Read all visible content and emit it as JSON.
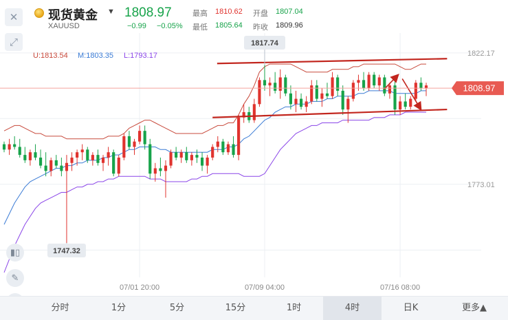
{
  "header": {
    "name": "现货黄金",
    "symbol": "XAUUSD",
    "price": "1808.97",
    "change": "−0.99",
    "change_pct": "−0.05%",
    "stats": [
      {
        "label": "最高",
        "value": "1810.62",
        "color": "#e0332e"
      },
      {
        "label": "开盘",
        "value": "1807.04",
        "color": "#17a34a"
      },
      {
        "label": "最低",
        "value": "1805.64",
        "color": "#17a34a"
      },
      {
        "label": "昨收",
        "value": "1809.96",
        "color": "#333333"
      }
    ]
  },
  "toolbar": {
    "close_icon": "close-icon",
    "expand_icon": "expand-icon",
    "side_tools": [
      "candle-type-icon",
      "pen-icon",
      "line-tool-icon"
    ]
  },
  "tabs": [
    {
      "label": "分时",
      "active": false
    },
    {
      "label": "1分",
      "active": false
    },
    {
      "label": "5分",
      "active": false
    },
    {
      "label": "15分",
      "active": false
    },
    {
      "label": "1时",
      "active": false
    },
    {
      "label": "4时",
      "active": true
    },
    {
      "label": "日K",
      "active": false
    },
    {
      "label": "更多▲",
      "active": false
    }
  ],
  "chart_data": {
    "type": "candlestick",
    "indicator": "Bollinger Bands",
    "bands_legend": {
      "upper": "U:1813.54",
      "middle": "M:1803.35",
      "lower": "L:1793.17"
    },
    "y_ticks": [
      "1822.17",
      "1773.01"
    ],
    "x_ticks": [
      "07/01 20:00",
      "07/09 04:00",
      "07/16 08:00"
    ],
    "last_price_label": "1808.97",
    "high_marker": "1817.74",
    "low_marker": "1747.32",
    "ylim": [
      1738.2,
      1829.6
    ],
    "colors": {
      "up": "#e0332e",
      "down": "#17a34a",
      "upper": "#c84a3c",
      "middle": "#3a7bd5",
      "lower": "#8a45e8"
    },
    "channel_lines": [
      {
        "from": [
          0.475,
          1818.2
        ],
        "to": [
          0.978,
          1820.0
        ]
      },
      {
        "from": [
          0.465,
          1798.0
        ],
        "to": [
          0.978,
          1801.0
        ]
      }
    ],
    "forecast_arrows": [
      {
        "from": [
          0.84,
          1808.5
        ],
        "to": [
          0.87,
          1813.8
        ]
      },
      {
        "from": [
          0.88,
          1812.5
        ],
        "to": [
          0.92,
          1801.2
        ]
      }
    ],
    "candles": [
      [
        1788.0,
        1789.0,
        1785.0,
        1786.0
      ],
      [
        1786.0,
        1790.0,
        1784.0,
        1788.0
      ],
      [
        1788.0,
        1791.0,
        1786.0,
        1787.0
      ],
      [
        1787.0,
        1790.0,
        1783.0,
        1784.0
      ],
      [
        1784.0,
        1787.0,
        1781.0,
        1782.0
      ],
      [
        1782.0,
        1786.0,
        1780.0,
        1785.0
      ],
      [
        1785.0,
        1788.0,
        1782.0,
        1783.0
      ],
      [
        1783.0,
        1786.0,
        1779.0,
        1780.0
      ],
      [
        1780.0,
        1785.0,
        1776.0,
        1778.0
      ],
      [
        1778.0,
        1783.0,
        1776.0,
        1782.0
      ],
      [
        1782.0,
        1784.0,
        1779.0,
        1780.0
      ],
      [
        1780.0,
        1783.0,
        1776.0,
        1778.0
      ],
      [
        1778.0,
        1784.0,
        1747.3,
        1781.0
      ],
      [
        1781.0,
        1785.0,
        1778.0,
        1783.0
      ],
      [
        1783.0,
        1786.0,
        1780.0,
        1785.0
      ],
      [
        1785.0,
        1788.0,
        1782.0,
        1786.0
      ],
      [
        1786.0,
        1787.0,
        1781.0,
        1782.0
      ],
      [
        1782.0,
        1785.0,
        1780.0,
        1784.0
      ],
      [
        1784.0,
        1786.0,
        1780.0,
        1781.0
      ],
      [
        1781.0,
        1784.0,
        1778.0,
        1783.0
      ],
      [
        1783.0,
        1787.0,
        1780.0,
        1785.0
      ],
      [
        1785.0,
        1786.0,
        1776.0,
        1777.0
      ],
      [
        1777.0,
        1784.0,
        1776.0,
        1783.0
      ],
      [
        1783.0,
        1792.0,
        1782.0,
        1791.0
      ],
      [
        1791.0,
        1793.0,
        1786.0,
        1787.0
      ],
      [
        1787.0,
        1790.0,
        1784.0,
        1789.0
      ],
      [
        1789.0,
        1795.0,
        1788.0,
        1793.0
      ],
      [
        1793.0,
        1795.0,
        1786.0,
        1788.0
      ],
      [
        1788.0,
        1790.0,
        1775.0,
        1777.0
      ],
      [
        1777.0,
        1781.0,
        1774.0,
        1779.0
      ],
      [
        1779.0,
        1783.0,
        1776.0,
        1778.0
      ],
      [
        1778.0,
        1782.0,
        1768.0,
        1780.0
      ],
      [
        1780.0,
        1786.0,
        1779.0,
        1785.0
      ],
      [
        1785.0,
        1787.0,
        1782.0,
        1783.0
      ],
      [
        1783.0,
        1786.0,
        1781.0,
        1785.0
      ],
      [
        1785.0,
        1787.0,
        1781.0,
        1782.0
      ],
      [
        1782.0,
        1785.0,
        1780.0,
        1784.0
      ],
      [
        1784.0,
        1786.0,
        1781.0,
        1783.0
      ],
      [
        1783.0,
        1785.0,
        1778.0,
        1780.0
      ],
      [
        1780.0,
        1784.0,
        1777.0,
        1783.0
      ],
      [
        1783.0,
        1788.0,
        1782.0,
        1787.0
      ],
      [
        1787.0,
        1791.0,
        1785.0,
        1789.0
      ],
      [
        1789.0,
        1790.0,
        1784.0,
        1785.0
      ],
      [
        1785.0,
        1789.0,
        1784.0,
        1788.0
      ],
      [
        1788.0,
        1791.0,
        1783.0,
        1784.0
      ],
      [
        1784.0,
        1799.0,
        1782.0,
        1798.0
      ],
      [
        1798.0,
        1803.0,
        1796.0,
        1800.0
      ],
      [
        1800.0,
        1802.0,
        1796.0,
        1797.0
      ],
      [
        1797.0,
        1805.0,
        1796.0,
        1803.0
      ],
      [
        1803.0,
        1813.0,
        1802.0,
        1812.0
      ],
      [
        1812.0,
        1817.7,
        1808.0,
        1810.0
      ],
      [
        1810.0,
        1813.0,
        1806.0,
        1811.0
      ],
      [
        1811.0,
        1815.0,
        1807.0,
        1808.0
      ],
      [
        1808.0,
        1816.0,
        1805.0,
        1813.0
      ],
      [
        1813.0,
        1814.0,
        1806.0,
        1807.0
      ],
      [
        1807.0,
        1810.0,
        1801.0,
        1803.0
      ],
      [
        1803.0,
        1808.0,
        1800.0,
        1805.0
      ],
      [
        1805.0,
        1807.0,
        1801.0,
        1802.0
      ],
      [
        1802.0,
        1806.0,
        1800.0,
        1804.0
      ],
      [
        1804.0,
        1812.0,
        1803.0,
        1810.0
      ],
      [
        1810.0,
        1812.0,
        1804.0,
        1805.0
      ],
      [
        1805.0,
        1809.0,
        1802.0,
        1807.0
      ],
      [
        1807.0,
        1811.0,
        1805.0,
        1806.0
      ],
      [
        1806.0,
        1815.0,
        1805.0,
        1813.0
      ],
      [
        1813.0,
        1814.0,
        1806.0,
        1808.0
      ],
      [
        1808.0,
        1810.0,
        1799.0,
        1801.0
      ],
      [
        1801.0,
        1806.0,
        1796.0,
        1805.0
      ],
      [
        1805.0,
        1812.0,
        1804.0,
        1811.0
      ],
      [
        1811.0,
        1814.0,
        1808.0,
        1812.0
      ],
      [
        1812.0,
        1815.0,
        1808.0,
        1809.0
      ],
      [
        1809.0,
        1815.0,
        1808.0,
        1814.0
      ],
      [
        1814.0,
        1815.0,
        1809.0,
        1810.0
      ],
      [
        1810.0,
        1814.0,
        1808.0,
        1813.0
      ],
      [
        1813.0,
        1814.0,
        1806.0,
        1807.0
      ],
      [
        1807.0,
        1811.0,
        1805.0,
        1810.0
      ],
      [
        1810.0,
        1812.0,
        1799.0,
        1801.0
      ],
      [
        1801.0,
        1806.0,
        1799.0,
        1804.0
      ],
      [
        1804.0,
        1807.0,
        1801.0,
        1802.0
      ],
      [
        1802.0,
        1806.0,
        1801.0,
        1805.0
      ],
      [
        1805.0,
        1812.0,
        1804.0,
        1811.0
      ],
      [
        1811.0,
        1813.0,
        1808.0,
        1809.0
      ],
      [
        1809.0,
        1811.0,
        1806.0,
        1810.0
      ]
    ],
    "bb_upper": [
      1793,
      1794,
      1795,
      1795,
      1794,
      1793,
      1792,
      1792,
      1791,
      1791,
      1791,
      1791,
      1790,
      1790,
      1790,
      1790,
      1790,
      1790,
      1790,
      1790,
      1791,
      1791,
      1791,
      1792,
      1794,
      1795,
      1796,
      1797,
      1797,
      1796,
      1795,
      1794,
      1793,
      1792,
      1792,
      1792,
      1792,
      1792,
      1792,
      1793,
      1794,
      1795,
      1795,
      1796,
      1796,
      1799,
      1803,
      1806,
      1810,
      1815,
      1817,
      1818,
      1818,
      1818,
      1818,
      1818,
      1817,
      1816,
      1815,
      1815,
      1815,
      1815,
      1815,
      1816,
      1816,
      1816,
      1816,
      1817,
      1817,
      1818,
      1818,
      1818,
      1818,
      1818,
      1818,
      1818,
      1817,
      1816,
      1816,
      1817,
      1818,
      1818
    ],
    "bb_middle": [
      1758,
      1762,
      1766,
      1769,
      1772,
      1774,
      1775,
      1776,
      1777,
      1778,
      1779,
      1779,
      1780,
      1780,
      1781,
      1781,
      1782,
      1782,
      1782,
      1783,
      1783,
      1784,
      1784,
      1785,
      1786,
      1786,
      1787,
      1787,
      1787,
      1787,
      1786,
      1786,
      1785,
      1785,
      1785,
      1785,
      1785,
      1785,
      1785,
      1785,
      1786,
      1786,
      1786,
      1787,
      1787,
      1788,
      1790,
      1791,
      1793,
      1795,
      1797,
      1798,
      1800,
      1801,
      1802,
      1802,
      1803,
      1803,
      1803,
      1804,
      1804,
      1804,
      1805,
      1805,
      1806,
      1806,
      1806,
      1806,
      1807,
      1807,
      1808,
      1808,
      1808,
      1808,
      1808,
      1807,
      1807,
      1807,
      1807,
      1807,
      1808,
      1808
    ],
    "bb_lower": [
      1740,
      1745,
      1750,
      1754,
      1758,
      1761,
      1764,
      1766,
      1767,
      1768,
      1769,
      1770,
      1770,
      1771,
      1772,
      1772,
      1773,
      1773,
      1774,
      1774,
      1775,
      1775,
      1776,
      1776,
      1776,
      1776,
      1776,
      1776,
      1775,
      1775,
      1775,
      1774,
      1774,
      1774,
      1774,
      1774,
      1775,
      1775,
      1776,
      1776,
      1777,
      1777,
      1777,
      1777,
      1777,
      1777,
      1776,
      1776,
      1776,
      1776,
      1777,
      1780,
      1783,
      1786,
      1788,
      1790,
      1792,
      1793,
      1794,
      1795,
      1795,
      1796,
      1796,
      1796,
      1796,
      1797,
      1797,
      1797,
      1797,
      1797,
      1797,
      1798,
      1798,
      1798,
      1799,
      1799,
      1799,
      1800,
      1800,
      1800,
      1800,
      1800
    ]
  }
}
